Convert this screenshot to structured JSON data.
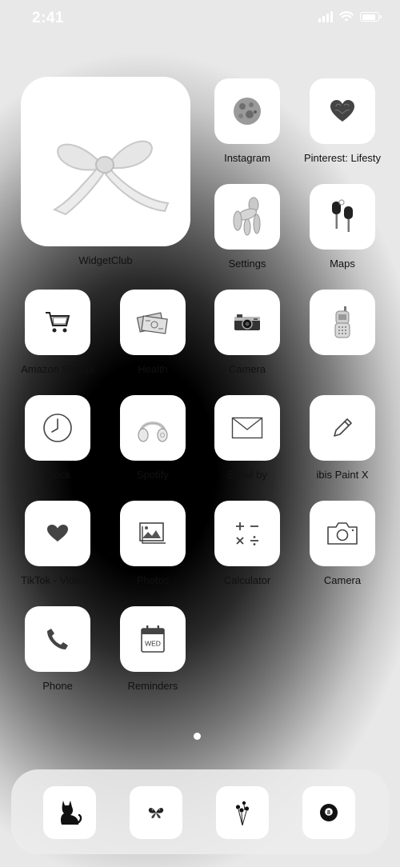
{
  "status_bar": {
    "time": "2:41"
  },
  "widget": {
    "label": "WidgetClub",
    "icon": "bow-icon"
  },
  "apps": [
    {
      "label": "Instagram",
      "icon": "moon-icon"
    },
    {
      "label": "Pinterest: Lifesty",
      "icon": "fingerprint-heart-icon"
    },
    {
      "label": "Settings",
      "icon": "balloon-dog-icon"
    },
    {
      "label": "Maps",
      "icon": "car-keys-icon"
    },
    {
      "label": "Amazon Shoppi",
      "icon": "shopping-cart-icon"
    },
    {
      "label": "Health",
      "icon": "money-stack-icon"
    },
    {
      "label": "Camera",
      "icon": "vintage-camera-icon"
    },
    {
      "label": "",
      "icon": "flip-phone-icon"
    },
    {
      "label": "Clock",
      "icon": "clock-icon"
    },
    {
      "label": "Spotify",
      "icon": "headphones-icon"
    },
    {
      "label": "Email by",
      "icon": "envelope-icon"
    },
    {
      "label": "ibis Paint X",
      "icon": "pencil-icon"
    },
    {
      "label": "TikTok - Videos,",
      "icon": "heart-icon"
    },
    {
      "label": "Photos",
      "icon": "photos-icon"
    },
    {
      "label": "Calculator",
      "icon": "calculator-icon"
    },
    {
      "label": "Camera",
      "icon": "camera-icon"
    },
    {
      "label": "Phone",
      "icon": "phone-icon"
    },
    {
      "label": "Reminders",
      "icon": "calendar-icon"
    }
  ],
  "calendar_day": "WED",
  "dock": [
    {
      "icon": "black-cat-icon"
    },
    {
      "icon": "butterfly-icon"
    },
    {
      "icon": "flowers-icon"
    },
    {
      "icon": "eight-ball-icon"
    }
  ],
  "eight_ball_number": "8"
}
